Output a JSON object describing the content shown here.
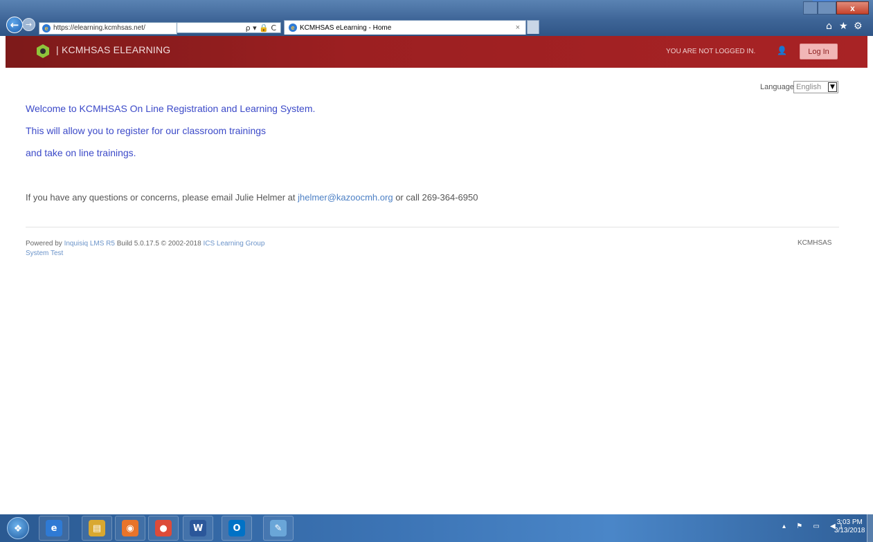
{
  "browser": {
    "address_url": "https://elearning.kcmhsas.net/",
    "address_tools": "ρ ▾ 🔒 C",
    "tab_title": "KCMHSAS eLearning - Home",
    "tab_close": "×",
    "close_glyph": "x",
    "toolbar_icons": {
      "home": "⌂",
      "favorites": "★",
      "tools": "⚙"
    }
  },
  "site": {
    "title": "KCMHSAS ELEARNING",
    "login_status": "YOU ARE NOT LOGGED IN.",
    "login_button": "Log In",
    "brand_color": "#9c1f21"
  },
  "language": {
    "label": "Language:",
    "selected": "English"
  },
  "content": {
    "welcome_lines": [
      "Welcome to KCMHSAS On Line Registration and Learning System.",
      "This will allow you to register for our classroom trainings",
      "and take on line trainings."
    ],
    "contact_prefix": "If you have any questions or concerns, please email Julie Helmer at ",
    "contact_email": "jhelmer@kazoocmh.org",
    "contact_suffix": " or call 269-364-6950"
  },
  "footer": {
    "powered_by": "Powered by ",
    "product_link": "Inquisiq LMS R5",
    "build": " Build 5.0.17.5  © 2002-2018  ",
    "company_link": "ICS Learning Group",
    "system_test": "System Test",
    "right_text": "KCMHSAS"
  },
  "taskbar": {
    "tray_icons": "▴ ⚑ ▭ ◀)",
    "time": "3:03 PM",
    "date": "3/13/2018",
    "apps": [
      {
        "name": "internet-explorer",
        "glyph": "e",
        "color": "#2f7ad4"
      },
      {
        "name": "file-explorer",
        "glyph": "▤",
        "color": "#d9a830"
      },
      {
        "name": "media-player",
        "glyph": "◉",
        "color": "#e8742a"
      },
      {
        "name": "chrome",
        "glyph": "●",
        "color": "#dd4b39"
      },
      {
        "name": "word",
        "glyph": "W",
        "color": "#2b579a"
      },
      {
        "name": "outlook",
        "glyph": "O",
        "color": "#0072c6"
      },
      {
        "name": "paint",
        "glyph": "✎",
        "color": "#6aa6d8"
      }
    ]
  }
}
